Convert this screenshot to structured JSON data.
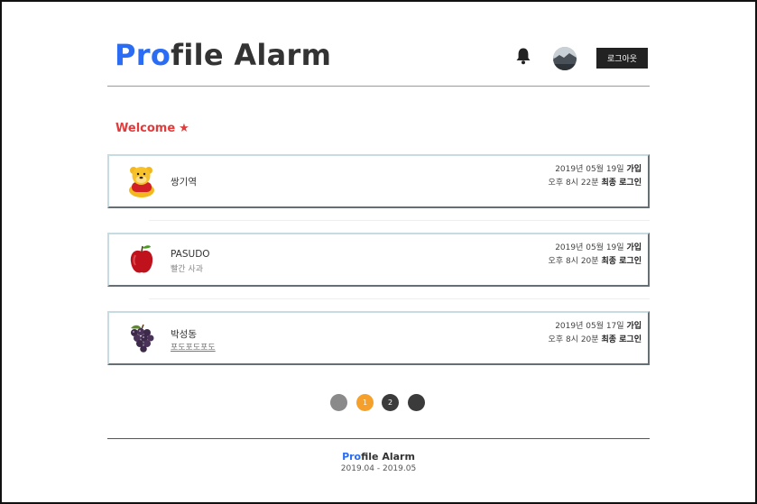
{
  "header": {
    "logo_accent": "Pro",
    "logo_rest": "file Alarm",
    "logout_label": "로그아웃",
    "bell_icon": "bell-icon",
    "avatar_icon": "avatar-image"
  },
  "welcome": {
    "text": "Welcome",
    "star": "★",
    "color": "#e23b3b"
  },
  "members": [
    {
      "name": "쌍기역",
      "sub": "",
      "joined_date": "2019년 05월 19일",
      "joined_label": "가입",
      "last_login_time": "오후 8시 22분",
      "last_login_label": "최종 로그인",
      "icon": "pooh-bear-icon"
    },
    {
      "name": "PASUDO",
      "sub": "빨간 사과",
      "joined_date": "2019년 05월 19일",
      "joined_label": "가입",
      "last_login_time": "오후 8시 20분",
      "last_login_label": "최종 로그인",
      "icon": "apple-icon"
    },
    {
      "name": "박성동",
      "sub": "포도포도포도",
      "joined_date": "2019년 05월 17일",
      "joined_label": "가입",
      "last_login_time": "오후 8시 20분",
      "last_login_label": "최종 로그인",
      "icon": "grapes-icon"
    }
  ],
  "pagination": {
    "pages": [
      "",
      "1",
      "2",
      ""
    ],
    "current": "1",
    "colors": {
      "prev": "#8a8a8a",
      "active": "#f5a02c",
      "page": "#3b3b3b",
      "next": "#3b3b3b"
    }
  },
  "footer": {
    "title_accent": "Pro",
    "title_rest": "file Alarm",
    "date_range": "2019.04 - 2019.05"
  },
  "colors": {
    "brand": "#2a6df4",
    "button_dark": "#222222"
  }
}
